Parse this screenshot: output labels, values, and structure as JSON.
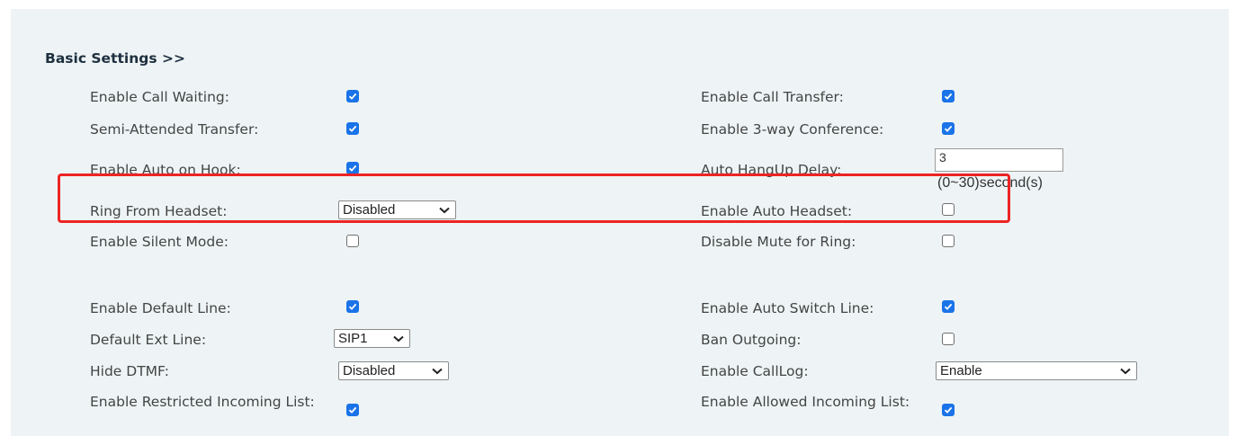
{
  "section_title": "Basic Settings >>",
  "rows": {
    "r1": {
      "left_label": "Enable Call Waiting:",
      "right_label": "Enable Call Transfer:"
    },
    "r2": {
      "left_label": "Semi-Attended Transfer:",
      "right_label": "Enable 3-way Conference:"
    },
    "r3": {
      "left_label": "Enable Auto on Hook:",
      "right_label": "Auto HangUp Delay:",
      "delay_value": "3",
      "delay_unit": "(0~30)second(s)"
    },
    "r4": {
      "left_label": "Ring From Headset:",
      "left_select": "Disabled",
      "right_label": "Enable Auto Headset:"
    },
    "r5": {
      "left_label": "Enable Silent Mode:",
      "right_label": "Disable Mute for Ring:"
    },
    "r6": {
      "left_label": "Enable Default Line:",
      "right_label": "Enable Auto Switch Line:"
    },
    "r7": {
      "left_label": "Default Ext Line:",
      "left_select": "SIP1",
      "right_label": "Ban Outgoing:"
    },
    "r8": {
      "left_label": "Hide DTMF:",
      "left_select": "Disabled",
      "right_label": "Enable CallLog:",
      "right_select": "Enable"
    },
    "r9": {
      "left_label": "Enable Restricted Incoming List:",
      "right_label": "Enable Allowed Incoming List:"
    }
  },
  "checkbox_states": {
    "call_waiting": true,
    "call_transfer": true,
    "semi_attended": true,
    "three_way": true,
    "auto_on_hook": true,
    "auto_headset": false,
    "silent_mode": false,
    "disable_mute_ring": false,
    "default_line": true,
    "auto_switch_line": true,
    "ban_outgoing": false,
    "restricted_incoming": true,
    "allowed_incoming": true
  },
  "colors": {
    "checkbox_checked": "#1a73e8",
    "highlight_box": "#ee2424",
    "panel_background": "#eef4f5"
  },
  "icons": {
    "checkbox": "check-icon",
    "select": "chevron-down-icon"
  }
}
